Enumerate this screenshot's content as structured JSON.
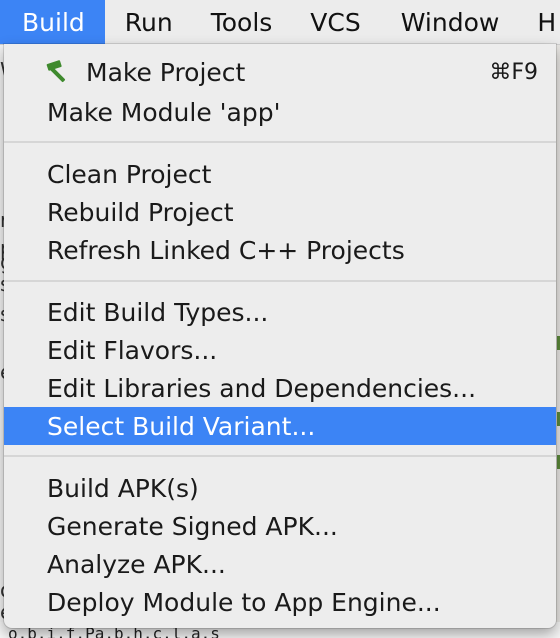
{
  "menubar": {
    "items": [
      {
        "label": "Build"
      },
      {
        "label": "Run"
      },
      {
        "label": "Tools"
      },
      {
        "label": "VCS"
      },
      {
        "label": "Window"
      },
      {
        "label": "H"
      }
    ]
  },
  "build_menu": {
    "groups": [
      [
        {
          "label": "Make Project",
          "shortcut": "⌘F9",
          "icon": "hammer-icon"
        },
        {
          "label": "Make Module 'app'"
        }
      ],
      [
        {
          "label": "Clean Project"
        },
        {
          "label": "Rebuild Project"
        },
        {
          "label": "Refresh Linked C++ Projects"
        }
      ],
      [
        {
          "label": "Edit Build Types..."
        },
        {
          "label": "Edit Flavors..."
        },
        {
          "label": "Edit Libraries and Dependencies..."
        },
        {
          "label": "Select Build Variant...",
          "highlighted": true
        }
      ],
      [
        {
          "label": "Build APK(s)"
        },
        {
          "label": "Generate Signed APK..."
        },
        {
          "label": "Analyze APK..."
        },
        {
          "label": "Deploy Module to App Engine..."
        }
      ]
    ]
  },
  "background": {
    "left_chars": [
      "W",
      "r",
      "p",
      "g",
      "s",
      "s",
      "e",
      "o",
      "e"
    ],
    "bottom_text": "o.b.i.f.Pa.b.h.c.l.a.s"
  },
  "colors": {
    "highlight": "#3c84f5",
    "menu_bg": "#ededed",
    "hammer": "#3f8a2e"
  }
}
